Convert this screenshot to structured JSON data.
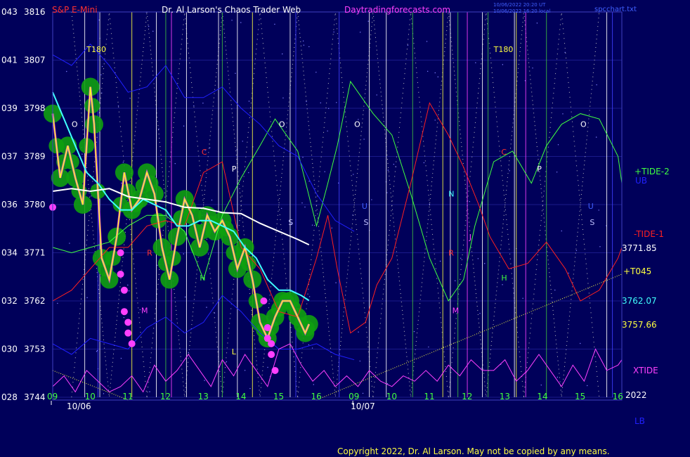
{
  "header": {
    "instrument": "S&P E-Mini",
    "title": "Dr. Al Larson's Chaos Trader Web",
    "site": "Daytradingforecasts.com",
    "stamp_line1": "10/06/2022 20:20 UT",
    "stamp_line2": "10/06/2022 16:20 local",
    "file": "spcchart.txt"
  },
  "copyright": "Copyright 2022, Dr. Al Larson. May not be copied by any means.",
  "colors": {
    "background": "#00005a",
    "grid": "#1a1a8a",
    "axis_text": "#ffffff",
    "instrument": "#ff3030",
    "title": "#ffffff",
    "site": "#ff40ff",
    "tide2": "#40ff40",
    "tide1": "#ff2020",
    "t045": "#ffff40",
    "cyan": "#40ffff",
    "xtide": "#ff40ff",
    "ub_lb": "#2020ff",
    "ma_white": "#ffffff",
    "price": "#ffff20",
    "pink": "#ff40ff",
    "green_blob": "#10a010",
    "copyright": "#ffff40"
  },
  "chart_data": {
    "type": "line",
    "ylim": [
      3744,
      3816
    ],
    "y_ticks": [
      {
        "left": "043",
        "right": "3816",
        "value": 3816
      },
      {
        "left": "041",
        "right": "3807",
        "value": 3807
      },
      {
        "left": "039",
        "right": "3798",
        "value": 3798
      },
      {
        "left": "037",
        "right": "3789",
        "value": 3789
      },
      {
        "left": "036",
        "right": "3780",
        "value": 3780
      },
      {
        "left": "034",
        "right": "3771",
        "value": 3771
      },
      {
        "left": "032",
        "right": "3762",
        "value": 3762
      },
      {
        "left": "030",
        "right": "3753",
        "value": 3753
      },
      {
        "left": "028",
        "right": "3744",
        "value": 3744
      }
    ],
    "x_hour_labels": [
      "09",
      "10",
      "11",
      "12",
      "13",
      "14",
      "15",
      "16",
      "09",
      "10",
      "11",
      "12",
      "13",
      "14",
      "15",
      "16"
    ],
    "date_labels": [
      "10/06",
      "10/07"
    ],
    "year_label": "2022",
    "right_labels": {
      "tide2": "+TIDE-2",
      "ub": "UB",
      "tide1": "-TIDE-1",
      "tide1_value": "3771.85",
      "t045": "+T045",
      "cyan_value": "3762.07",
      "yellow_value": "3757.66",
      "xtide": "XTIDE",
      "lb": "LB"
    },
    "markers": [
      {
        "text": "T180",
        "hour": 9.9,
        "price": 3808.5
      },
      {
        "text": "T180",
        "hour": 20.7,
        "price": 3808.5
      },
      {
        "text": "O",
        "hour": 9.5,
        "price": 3794.5
      },
      {
        "text": "O",
        "hour": 15.0,
        "price": 3794.5
      },
      {
        "text": "O",
        "hour": 17.0,
        "price": 3794.5
      },
      {
        "text": "O",
        "hour": 23.0,
        "price": 3794.5
      },
      {
        "text": "C",
        "hour": 12.95,
        "price": 3789.3
      },
      {
        "text": "C",
        "hour": 20.9,
        "price": 3789.3
      },
      {
        "text": "P",
        "hour": 13.75,
        "price": 3786.2
      },
      {
        "text": "P",
        "hour": 21.85,
        "price": 3786.2
      },
      {
        "text": "S",
        "hour": 15.25,
        "price": 3776.2
      },
      {
        "text": "S",
        "hour": 17.25,
        "price": 3776.2
      },
      {
        "text": "S",
        "hour": 23.25,
        "price": 3776.2
      },
      {
        "text": "U",
        "hour": 17.2,
        "price": 3779.2
      },
      {
        "text": "U",
        "hour": 23.2,
        "price": 3779.2
      },
      {
        "text": "N",
        "hour": 19.5,
        "price": 3781.5
      },
      {
        "text": "J",
        "hour": 20.05,
        "price": 3773.4
      },
      {
        "text": "H",
        "hour": 12.9,
        "price": 3765.8
      },
      {
        "text": "H",
        "hour": 20.9,
        "price": 3765.8
      },
      {
        "text": "R",
        "hour": 11.5,
        "price": 3770.5
      },
      {
        "text": "R",
        "hour": 19.5,
        "price": 3770.5
      },
      {
        "text": "M",
        "hour": 11.35,
        "price": 3759.7
      },
      {
        "text": "M",
        "hour": 19.6,
        "price": 3759.7
      },
      {
        "text": "L",
        "hour": 13.75,
        "price": 3752.0
      }
    ],
    "series": [
      {
        "name": "+TIDE-2",
        "x": [
          9,
          9.5,
          10,
          10.5,
          11,
          11.5,
          12,
          12.5,
          13,
          13.5,
          14,
          14.5,
          14.9,
          15.5,
          16,
          16.3,
          16.55,
          16.9,
          17.5,
          18,
          18.5,
          19,
          19.5,
          19.9,
          20.2,
          20.7,
          21.2,
          21.7,
          22.1,
          22.5,
          23,
          23.5,
          24,
          24.1
        ],
        "values": [
          3772,
          3771,
          3772,
          3773,
          3776,
          3778,
          3778,
          3775,
          3766,
          3778,
          3785,
          3791,
          3796,
          3790,
          3776,
          3784,
          3791,
          3803,
          3797,
          3793,
          3782,
          3770,
          3762,
          3766,
          3776,
          3788,
          3790,
          3784,
          3791,
          3795,
          3797,
          3796,
          3789,
          3784
        ]
      },
      {
        "name": "-TIDE-1",
        "x": [
          9,
          9.5,
          10,
          10.5,
          11,
          11.5,
          12,
          12.5,
          13,
          13.5,
          14,
          14.5,
          15,
          15.5,
          16,
          16.3,
          16.55,
          16.9,
          17.3,
          17.6,
          18,
          18.5,
          19,
          19.5,
          19.9,
          20.3,
          20.6,
          21.1,
          21.6,
          22.1,
          22.6,
          23,
          23.5,
          24,
          24.1
        ],
        "values": [
          3762,
          3764,
          3768,
          3772,
          3772,
          3776,
          3777,
          3776,
          3786,
          3788,
          3772,
          3768,
          3760,
          3759,
          3770,
          3778,
          3768,
          3756,
          3758,
          3765,
          3770,
          3784,
          3799,
          3793,
          3787,
          3780,
          3774,
          3768,
          3769,
          3773,
          3768,
          3762,
          3764,
          3770,
          3772
        ]
      },
      {
        "name": "UB",
        "x": [
          9,
          9.5,
          10,
          10.5,
          11,
          11.5,
          12,
          12.5,
          13,
          13.5,
          14,
          14.5,
          15,
          15.5,
          16,
          16.5,
          17
        ],
        "values": [
          3808,
          3806,
          3810,
          3806,
          3801,
          3802,
          3806,
          3800,
          3800,
          3802,
          3798,
          3795,
          3791,
          3789,
          3782,
          3777,
          3775
        ]
      },
      {
        "name": "LB",
        "x": [
          9,
          9.5,
          10,
          10.5,
          11,
          11.5,
          12,
          12.5,
          13,
          13.5,
          14,
          14.5,
          15,
          15.5,
          16,
          16.5,
          17
        ],
        "values": [
          3754,
          3752,
          3755,
          3754,
          3753,
          3757,
          3759,
          3756,
          3758,
          3763,
          3760,
          3756,
          3753,
          3753,
          3754,
          3752,
          3751
        ]
      },
      {
        "name": "XTIDE",
        "x": [
          9,
          9.3,
          9.6,
          9.9,
          10.2,
          10.5,
          10.8,
          11.1,
          11.4,
          11.7,
          12,
          12.3,
          12.6,
          12.9,
          13.2,
          13.5,
          13.8,
          14.1,
          14.4,
          14.7,
          15,
          15.3,
          15.6,
          15.9,
          16.2,
          16.5,
          16.8,
          17.1,
          17.4,
          17.7,
          18,
          18.3,
          18.6,
          18.9,
          19.2,
          19.5,
          19.8,
          20.1,
          20.4,
          20.7,
          21,
          21.3,
          21.6,
          21.9,
          22.2,
          22.5,
          22.8,
          23.1,
          23.4,
          23.7,
          24,
          24.1
        ],
        "values": [
          3746,
          3748,
          3745,
          3749,
          3747,
          3745,
          3746,
          3748,
          3745,
          3750,
          3747,
          3749,
          3752,
          3749,
          3746,
          3751,
          3748,
          3752,
          3749,
          3746,
          3753,
          3754,
          3750,
          3747,
          3749,
          3746,
          3748,
          3746,
          3749,
          3747,
          3746,
          3748,
          3747,
          3749,
          3747,
          3750,
          3748,
          3751,
          3749,
          3749,
          3751,
          3747,
          3749,
          3752,
          3749,
          3746,
          3750,
          3747,
          3753,
          3749,
          3750,
          3751
        ]
      },
      {
        "name": "3757.66",
        "x": [
          9,
          9.2,
          9.4,
          9.6,
          9.8,
          10,
          10.1,
          10.3,
          10.5,
          10.7,
          10.9,
          11.1,
          11.3,
          11.5,
          11.7,
          11.9,
          12.1,
          12.3,
          12.5,
          12.7,
          12.9,
          13.1,
          13.3,
          13.5,
          13.7,
          13.9,
          14.1,
          14.3,
          14.5,
          14.7,
          14.9,
          15.1,
          15.3,
          15.5,
          15.7,
          15.8
        ],
        "values": [
          3797,
          3785,
          3791,
          3785,
          3780,
          3802,
          3795,
          3770,
          3766,
          3774,
          3786,
          3779,
          3781,
          3786,
          3782,
          3772,
          3766,
          3774,
          3781,
          3778,
          3772,
          3778,
          3775,
          3777,
          3774,
          3768,
          3772,
          3766,
          3758,
          3755,
          3759,
          3762,
          3762,
          3759,
          3756,
          3757.66
        ]
      },
      {
        "name": "3762.07",
        "x": [
          9,
          9.3,
          9.6,
          9.9,
          10.2,
          10.5,
          10.8,
          11.1,
          11.4,
          11.7,
          12,
          12.3,
          12.6,
          12.9,
          13.2,
          13.5,
          13.8,
          14.1,
          14.4,
          14.7,
          15,
          15.3,
          15.6,
          15.8
        ],
        "values": [
          3801,
          3796,
          3791,
          3786,
          3784,
          3781,
          3779,
          3779,
          3781,
          3780,
          3779,
          3776,
          3776,
          3777,
          3777,
          3776,
          3775,
          3772,
          3770,
          3766,
          3764,
          3764,
          3763,
          3762.07
        ]
      },
      {
        "name": "MA",
        "x": [
          9,
          9.5,
          10,
          10.5,
          11,
          11.5,
          12,
          12.5,
          13,
          13.5,
          14,
          14.5,
          15,
          15.5,
          15.8
        ],
        "values": [
          3782.5,
          3783,
          3782.5,
          3783,
          3781.5,
          3781,
          3780.5,
          3779.5,
          3779.3,
          3778.5,
          3778.3,
          3776.5,
          3775,
          3773.5,
          3772.5
        ]
      },
      {
        "name": "+T045",
        "x": [
          16,
          24.1
        ],
        "values": [
          3743.5,
          3767
        ]
      },
      {
        "name": "T045-left",
        "x": [
          9,
          11
        ],
        "values": [
          3749,
          3743.5
        ]
      },
      {
        "name": "dots",
        "x": [
          9,
          10.8,
          10.8,
          10.9,
          10.9,
          11,
          11,
          11.1,
          14.6,
          14.7,
          14.7,
          14.8,
          14.8,
          14.9
        ],
        "values": [
          3779.5,
          3771,
          3767,
          3764,
          3760,
          3758,
          3756,
          3754,
          3762,
          3757,
          3755,
          3754,
          3752,
          3749
        ]
      }
    ],
    "vertical_lines": [
      {
        "hour": 9.85,
        "color": "white"
      },
      {
        "hour": 10.2,
        "color": "blue"
      },
      {
        "hour": 10.25,
        "color": "white"
      },
      {
        "hour": 11.1,
        "color": "yellow"
      },
      {
        "hour": 11.75,
        "color": "white"
      },
      {
        "hour": 12.0,
        "color": "green"
      },
      {
        "hour": 12.15,
        "color": "magenta"
      },
      {
        "hour": 12.55,
        "color": "white"
      },
      {
        "hour": 13.4,
        "color": "white"
      },
      {
        "hour": 13.5,
        "color": "green"
      },
      {
        "hour": 13.9,
        "color": "white"
      },
      {
        "hour": 14.3,
        "color": "yellow"
      },
      {
        "hour": 15.3,
        "color": "white"
      },
      {
        "hour": 15.45,
        "color": "blue"
      },
      {
        "hour": 16.6,
        "color": "blue"
      },
      {
        "hour": 17.4,
        "color": "white"
      },
      {
        "hour": 17.85,
        "color": "white"
      },
      {
        "hour": 18.55,
        "color": "green"
      },
      {
        "hour": 19.35,
        "color": "yellow"
      },
      {
        "hour": 19.55,
        "color": "white"
      },
      {
        "hour": 19.75,
        "color": "green"
      },
      {
        "hour": 20.0,
        "color": "magenta"
      },
      {
        "hour": 20.4,
        "color": "white"
      },
      {
        "hour": 20.55,
        "color": "green"
      },
      {
        "hour": 21.25,
        "color": "white"
      },
      {
        "hour": 21.3,
        "color": "yellow"
      },
      {
        "hour": 21.55,
        "color": "magenta"
      },
      {
        "hour": 22.1,
        "color": "green"
      },
      {
        "hour": 23.7,
        "color": "white"
      },
      {
        "hour": 23.85,
        "color": "blue"
      }
    ],
    "grid": true
  }
}
